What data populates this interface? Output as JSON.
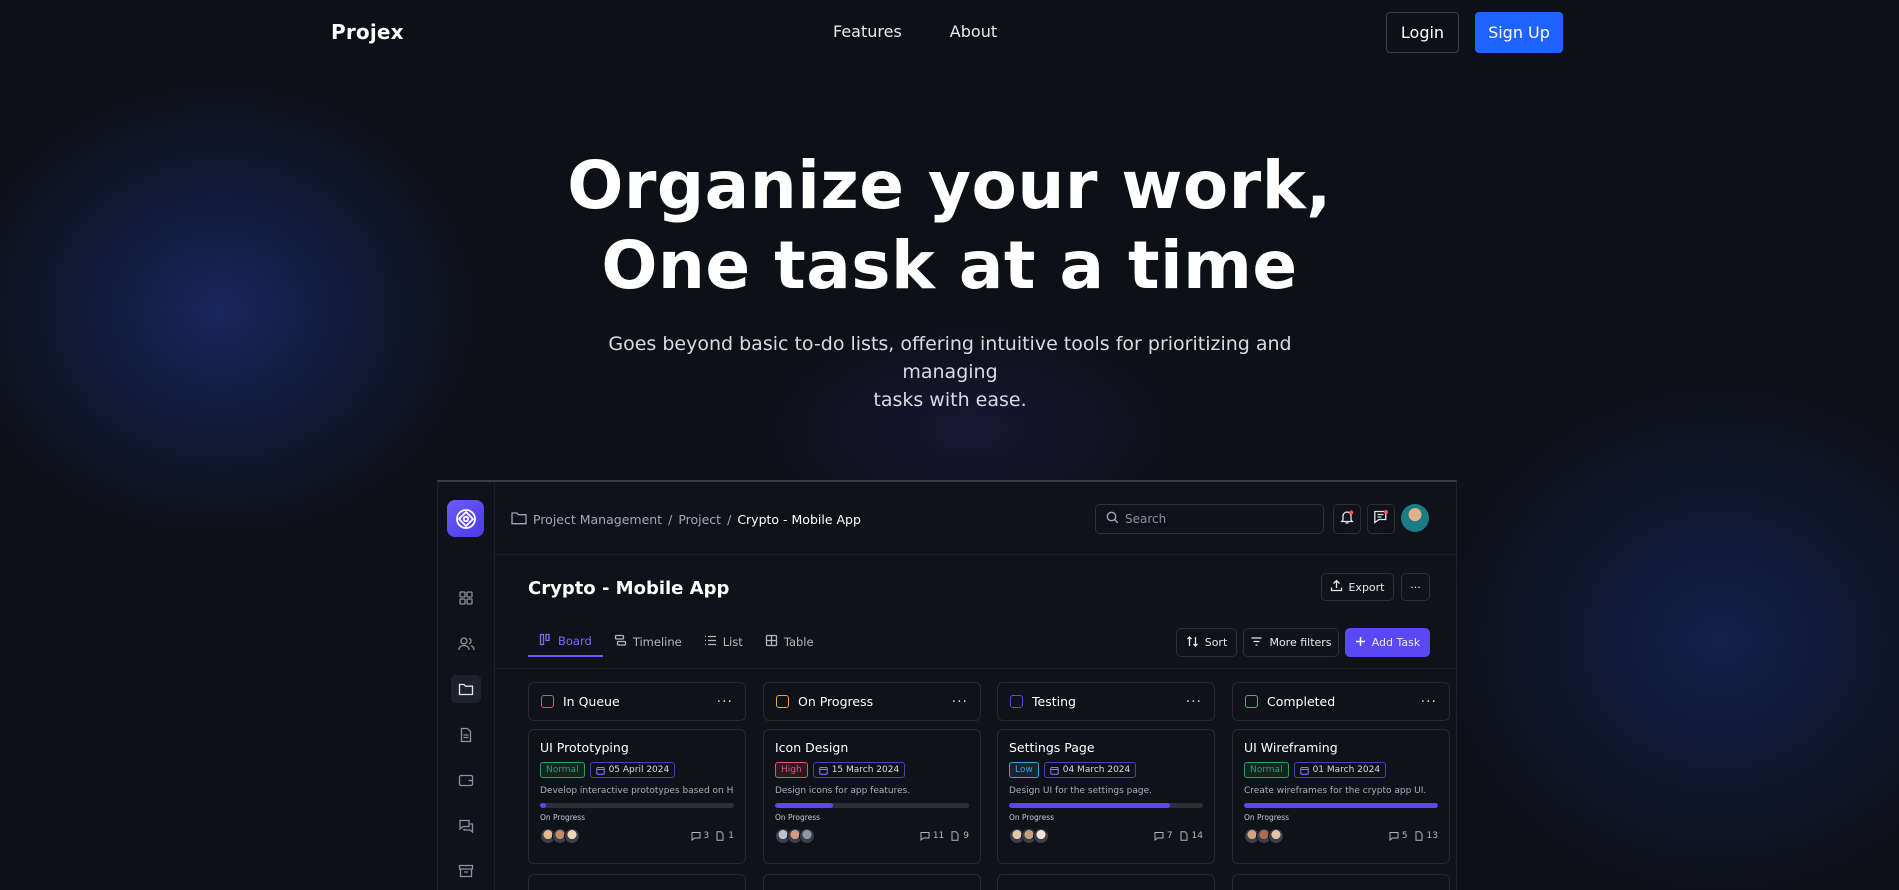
{
  "nav": {
    "brand": "Projex",
    "links": [
      "Features",
      "About"
    ],
    "login": "Login",
    "signup": "Sign Up"
  },
  "hero": {
    "title_line1": "Organize your work,",
    "title_line2": "One task at a time",
    "subtitle_line1": "Goes beyond basic to-do lists, offering intuitive tools for prioritizing and managing",
    "subtitle_line2": "tasks with ease."
  },
  "app": {
    "breadcrumb": [
      "Project Management",
      "Project",
      "Crypto - Mobile App"
    ],
    "search_placeholder": "Search",
    "project_title": "Crypto - Mobile App",
    "export_label": "Export",
    "tabs": [
      "Board",
      "Timeline",
      "List",
      "Table"
    ],
    "sort_label": "Sort",
    "filters_label": "More filters",
    "add_task_label": "Add Task",
    "columns": [
      {
        "name": "In Queue",
        "color": "#e0566b",
        "card": {
          "title": "UI Prototyping",
          "priority": "Normal",
          "date": "05 April 2024",
          "description": "Develop interactive prototypes based on HiFi",
          "progress": 0.03,
          "status": "On Progress",
          "comments": "3",
          "files": "1"
        }
      },
      {
        "name": "On Progress",
        "color": "#e2a83b",
        "card": {
          "title": "Icon Design",
          "priority": "High",
          "date": "15 March 2024",
          "description": "Design icons for app features.",
          "progress": 0.3,
          "status": "On Progress",
          "comments": "11",
          "files": "9"
        }
      },
      {
        "name": "Testing",
        "color": "#5a48f5",
        "card": {
          "title": "Settings Page",
          "priority": "Low",
          "date": "04 March 2024",
          "description": "Design UI for the settings page.",
          "progress": 0.83,
          "status": "On Progress",
          "comments": "7",
          "files": "14"
        }
      },
      {
        "name": "Completed",
        "color": "#4bb56a",
        "card": {
          "title": "UI Wireframing",
          "priority": "Normal",
          "date": "01 March 2024",
          "description": "Create wireframes for the crypto app UI.",
          "progress": 1.0,
          "status": "On Progress",
          "comments": "5",
          "files": "13"
        }
      }
    ]
  },
  "colors": {
    "background": "#0d1017",
    "accent_blue": "#1d63ff",
    "accent_purple": "#5a48f5",
    "priority_normal": "#2f9e5b",
    "priority_high": "#e0566b",
    "priority_low": "#3aa6d8"
  }
}
